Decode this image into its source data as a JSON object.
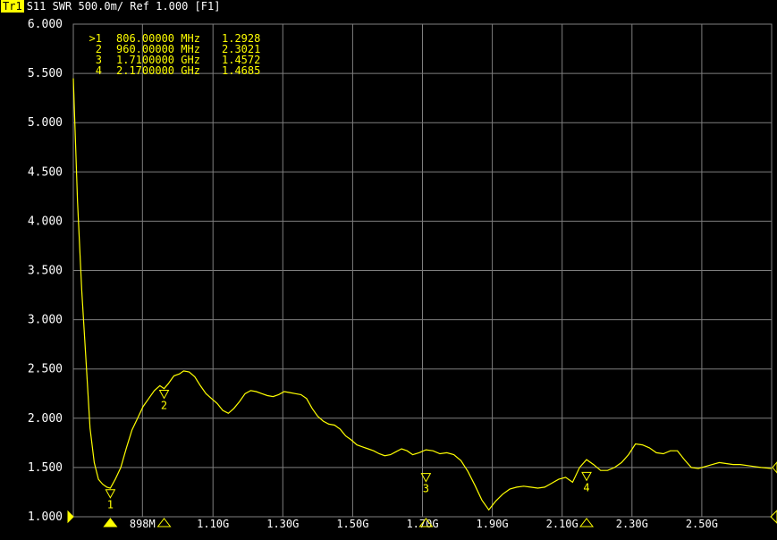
{
  "title_bar": {
    "trace_label": "Tr1",
    "trace_text": "S11  SWR 500.0m/  Ref 1.000  [F1]"
  },
  "colors": {
    "background": "#000000",
    "grid": "#7f7f7f",
    "trace": "#ffff00",
    "text": "#ffffff",
    "marker_text": "#ffff00"
  },
  "markers_table": [
    {
      "num": ">1",
      "freq": "806.00000 MHz",
      "value": "1.2928"
    },
    {
      "num": "2",
      "freq": "960.00000 MHz",
      "value": "2.3021"
    },
    {
      "num": "3",
      "freq": "1.7100000 GHz",
      "value": "1.4572"
    },
    {
      "num": "4",
      "freq": "2.1700000 GHz",
      "value": "1.4685"
    }
  ],
  "chart_data": {
    "type": "line",
    "ylim": [
      1.0,
      6.0
    ],
    "y_ticks": [
      "6.000",
      "5.500",
      "5.000",
      "4.500",
      "4.000",
      "3.500",
      "3.000",
      "2.500",
      "2.000",
      "1.500",
      "1.000"
    ],
    "xlim_mhz": [
      700,
      2700
    ],
    "x_ticks": [
      {
        "label": "898M",
        "mhz": 898
      },
      {
        "label": "1.10G",
        "mhz": 1100
      },
      {
        "label": "1.30G",
        "mhz": 1300
      },
      {
        "label": "1.50G",
        "mhz": 1500
      },
      {
        "label": "1.70G",
        "mhz": 1700
      },
      {
        "label": "1.90G",
        "mhz": 1900
      },
      {
        "label": "2.10G",
        "mhz": 2100
      },
      {
        "label": "2.30G",
        "mhz": 2300
      },
      {
        "label": "2.50G",
        "mhz": 2500
      }
    ],
    "grid": true,
    "series": [
      {
        "x_mhz": [
          700,
          712,
          724,
          736,
          748,
          760,
          772,
          784,
          796,
          806,
          820,
          836,
          852,
          868,
          884,
          900,
          916,
          932,
          948,
          960,
          972,
          988,
          1004,
          1016,
          1032,
          1048,
          1064,
          1080,
          1096,
          1112,
          1128,
          1144,
          1160,
          1176,
          1192,
          1208,
          1224,
          1240,
          1256,
          1272,
          1288,
          1304,
          1320,
          1336,
          1352,
          1368,
          1384,
          1400,
          1416,
          1432,
          1448,
          1464,
          1480,
          1496,
          1512,
          1528,
          1544,
          1560,
          1576,
          1592,
          1608,
          1624,
          1640,
          1656,
          1672,
          1690,
          1710,
          1730,
          1750,
          1770,
          1790,
          1810,
          1830,
          1850,
          1870,
          1890,
          1910,
          1930,
          1950,
          1970,
          1990,
          2010,
          2030,
          2050,
          2070,
          2090,
          2110,
          2130,
          2150,
          2170,
          2190,
          2210,
          2230,
          2250,
          2270,
          2290,
          2310,
          2330,
          2350,
          2370,
          2390,
          2410,
          2430,
          2450,
          2470,
          2490,
          2510,
          2530,
          2550,
          2570,
          2590,
          2610,
          2630,
          2650,
          2670,
          2700
        ],
        "y": [
          5.45,
          4.2,
          3.3,
          2.6,
          1.9,
          1.55,
          1.38,
          1.33,
          1.3,
          1.29,
          1.38,
          1.5,
          1.7,
          1.88,
          2.0,
          2.12,
          2.2,
          2.28,
          2.33,
          2.3,
          2.35,
          2.43,
          2.45,
          2.48,
          2.47,
          2.42,
          2.33,
          2.25,
          2.2,
          2.15,
          2.08,
          2.05,
          2.1,
          2.17,
          2.25,
          2.28,
          2.27,
          2.25,
          2.23,
          2.22,
          2.24,
          2.27,
          2.26,
          2.25,
          2.24,
          2.2,
          2.1,
          2.02,
          1.97,
          1.94,
          1.93,
          1.89,
          1.82,
          1.78,
          1.73,
          1.71,
          1.69,
          1.67,
          1.64,
          1.62,
          1.63,
          1.66,
          1.69,
          1.67,
          1.63,
          1.65,
          1.68,
          1.67,
          1.64,
          1.65,
          1.63,
          1.57,
          1.46,
          1.32,
          1.17,
          1.07,
          1.16,
          1.23,
          1.28,
          1.3,
          1.31,
          1.3,
          1.29,
          1.3,
          1.34,
          1.38,
          1.4,
          1.35,
          1.5,
          1.58,
          1.53,
          1.47,
          1.47,
          1.5,
          1.55,
          1.63,
          1.74,
          1.73,
          1.7,
          1.65,
          1.64,
          1.67,
          1.67,
          1.58,
          1.5,
          1.49,
          1.51,
          1.53,
          1.55,
          1.54,
          1.53,
          1.53,
          1.52,
          1.51,
          1.5,
          1.49,
          1.47
        ],
        "x_unit": "MHz"
      }
    ],
    "markers": [
      {
        "label": "1",
        "x_mhz": 806,
        "y": 1.2928
      },
      {
        "label": "2",
        "x_mhz": 960,
        "y": 2.3021
      },
      {
        "label": "3",
        "x_mhz": 1710,
        "y": 1.4572
      },
      {
        "label": "4",
        "x_mhz": 2170,
        "y": 1.4685
      }
    ],
    "axis_markers_mhz": [
      {
        "x_mhz": 806,
        "filled": true
      },
      {
        "x_mhz": 960,
        "filled": false
      },
      {
        "x_mhz": 1710,
        "filled": false
      },
      {
        "x_mhz": 2170,
        "filled": false
      }
    ]
  }
}
